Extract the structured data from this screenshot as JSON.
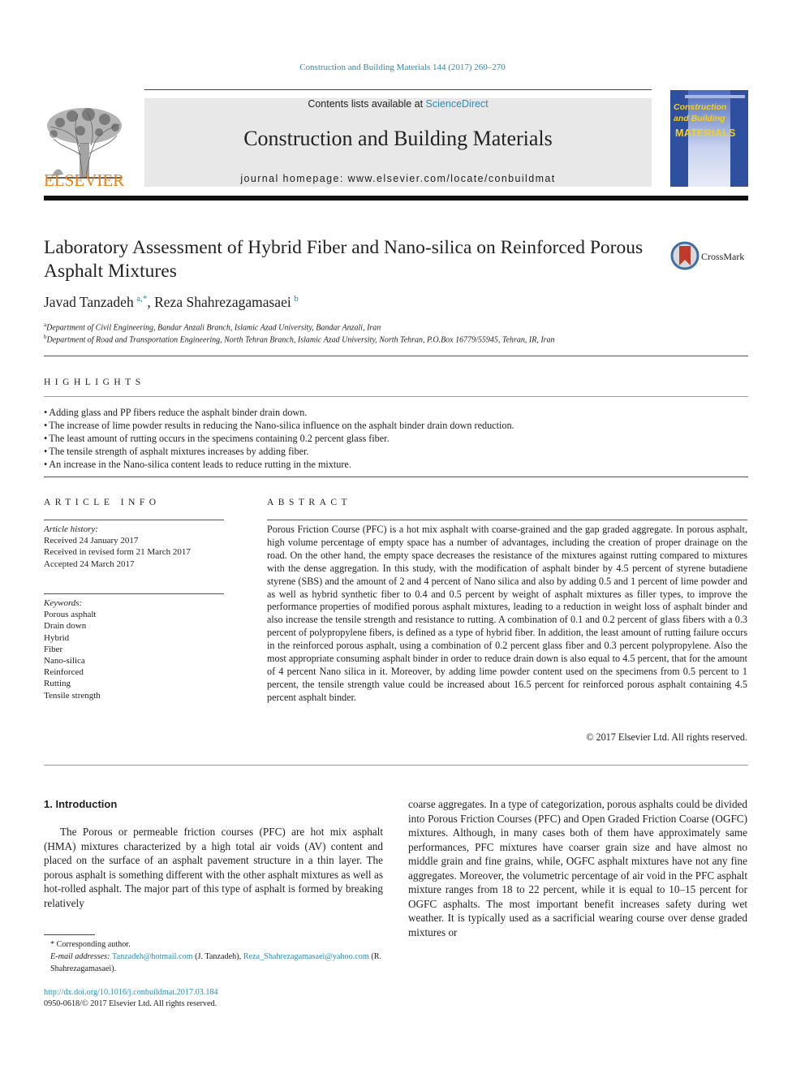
{
  "header": {
    "journal_ref": "Construction and Building Materials 144 (2017) 260–270",
    "contents_prefix": "Contents lists available at ",
    "contents_link": "ScienceDirect",
    "journal_name": "Construction and Building Materials",
    "homepage": "journal homepage: www.elsevier.com/locate/conbuildmat",
    "publisher_wordmark": "ELSEVIER",
    "cover": {
      "title_line1": "Construction",
      "title_line2": "and Building",
      "title_line3": "MATERIALS"
    },
    "crossmark_label": "CrossMark"
  },
  "article": {
    "title": "Laboratory Assessment of Hybrid Fiber and Nano-silica on Reinforced Porous Asphalt Mixtures",
    "authors": [
      {
        "name": "Javad Tanzadeh",
        "sup": "a,*"
      },
      {
        "name": "Reza Shahrezagamasaei",
        "sup": "b"
      }
    ],
    "affiliations": [
      {
        "key": "a",
        "text": "Department of Civil Engineering, Bandar Anzali Branch, Islamic Azad University, Bandar Anzali, Iran"
      },
      {
        "key": "b",
        "text": "Department of Road and Transportation Engineering, North Tehran Branch, Islamic Azad University, North Tehran, P.O.Box 16779/55945, Tehran, IR, Iran"
      }
    ]
  },
  "highlights": {
    "heading": "HIGHLIGHTS",
    "items": [
      "Adding glass and PP fibers reduce the asphalt binder drain down.",
      "The increase of lime powder results in reducing the Nano-silica influence on the asphalt binder drain down reduction.",
      "The least amount of rutting occurs in the specimens containing 0.2 percent glass fiber.",
      "The tensile strength of asphalt mixtures increases by adding fiber.",
      "An increase in the Nano-silica content leads to reduce rutting in the mixture."
    ]
  },
  "article_info": {
    "heading": "ARTICLE INFO",
    "history_label": "Article history:",
    "history": [
      "Received 24 January 2017",
      "Received in revised form 21 March 2017",
      "Accepted 24 March 2017"
    ],
    "keywords_label": "Keywords:",
    "keywords": [
      "Porous asphalt",
      "Drain down",
      "Hybrid",
      "Fiber",
      "Nano-silica",
      "Reinforced",
      "Rutting",
      "Tensile strength"
    ]
  },
  "abstract": {
    "heading": "ABSTRACT",
    "text": "Porous Friction Course (PFC) is a hot mix asphalt with coarse-grained and the gap graded aggregate. In porous asphalt, high volume percentage of empty space has a number of advantages, including the cre­ation of proper drainage on the road. On the other hand, the empty space decreases the resistance of the mixtures against rutting compared to mixtures with the dense aggregation. In this study, with the mod­ification of asphalt binder by 4.5 percent of styrene butadiene styrene (SBS) and the amount of 2 and 4 percent of Nano silica and also by adding 0.5 and 1 percent of lime powder and as well as hybrid synthetic fiber to 0.4 and 0.5 percent by weight of asphalt mixtures as filler types, to improve the performance properties of modified porous asphalt mixtures, leading to a reduction in weight loss of asphalt binder and also increase the tensile strength and resistance to rutting. A combination of 0.1 and 0.2 percent of glass fibers with a 0.3 percent of polypropylene fibers, is defined as a type of hybrid fiber. In addition, the least amount of rutting failure occurs in the reinforced porous asphalt, using a combination of 0.2 per­cent glass fiber and 0.3 percent polypropylene. Also the most appropriate consuming asphalt binder in order to reduce drain down is also equal to 4.5 percent, that for the amount of 4 percent Nano silica in it. Moreover, by adding lime powder content used on the specimens from 0.5 percent to 1 percent, the tensile strength value could be increased about 16.5 percent for reinforced porous asphalt containing 4.5 percent asphalt binder.",
    "copyright": "© 2017 Elsevier Ltd. All rights reserved."
  },
  "introduction": {
    "heading": "1. Introduction",
    "col1": "The Porous or permeable friction courses (PFC) are hot mix asphalt (HMA) mixtures characterized by a high total air voids (AV) content and placed on the surface of an asphalt pavement structure in a thin layer. The porous asphalt is something different with the other asphalt mixtures as well as hot-rolled asphalt. The major part of this type of asphalt is formed by breaking relatively",
    "col2": "coarse aggregates. In a type of categorization, porous asphalts could be divided into Porous Friction Courses (PFC) and Open Graded Friction Coarse (OGFC) mixtures. Although, in many cases both of them have approximately same performances, PFC mix­tures have coarser grain size and have almost no middle grain and fine grains, while, OGFC asphalt mixtures have not any fine aggregates. Moreover, the volumetric percentage of air void in the PFC asphalt mixture ranges from 18 to 22 percent, while it is equal to 10–15 percent for OGFC asphalts. The most important benefit increases safety during wet weather. It is typically used as a sacrificial wearing course over dense graded mixtures or"
  },
  "footnotes": {
    "corresponding": "* Corresponding author.",
    "email_label": "E-mail addresses: ",
    "email1": "Tanzadeh@hotmail.com",
    "email1_owner": " (J. Tanzadeh), ",
    "email2": "Reza_Shahrezagamasaei@yahoo.com",
    "email2_owner": " (R. Shahrezagamasaei).",
    "doi": "http://dx.doi.org/10.1016/j.conbuildmat.2017.03.184",
    "issn_line": "0950-0618/© 2017 Elsevier Ltd. All rights reserved."
  }
}
